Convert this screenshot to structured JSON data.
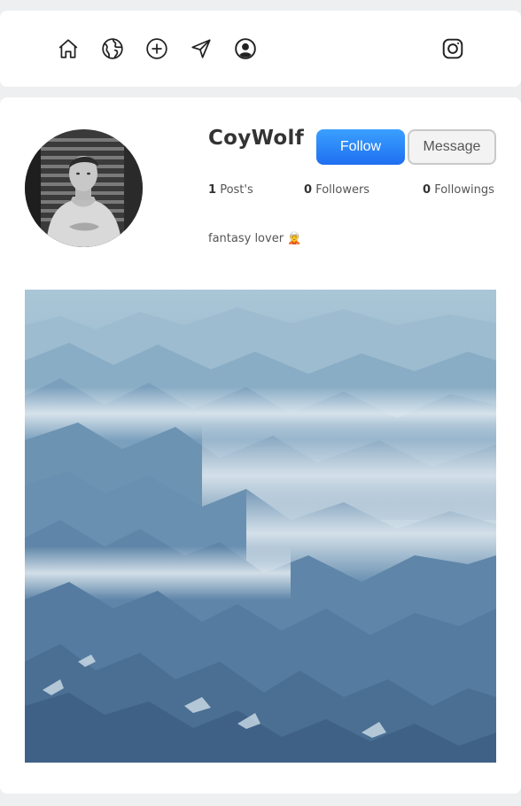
{
  "nav": {
    "items": [
      {
        "name": "home",
        "icon": "home-icon"
      },
      {
        "name": "explore",
        "icon": "globe-icon"
      },
      {
        "name": "create",
        "icon": "plus-circle-icon"
      },
      {
        "name": "direct",
        "icon": "send-arrow-icon"
      },
      {
        "name": "profile",
        "icon": "user-circle-icon"
      }
    ],
    "logo_icon": "instagram-icon"
  },
  "profile": {
    "username": "CoyWolf",
    "follow_label": "Follow",
    "message_label": "Message",
    "posts_count": "1",
    "posts_label": "Post's",
    "followers_count": "0",
    "followers_label": "Followers",
    "followings_count": "0",
    "followings_label": "Followings",
    "bio": "fantasy lover 🧝"
  },
  "colors": {
    "accent": "#1f6ff0",
    "page_bg": "#eeeff1"
  }
}
